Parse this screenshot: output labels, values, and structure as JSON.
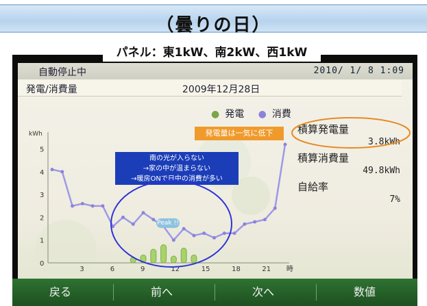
{
  "banner": {
    "title": "（曇りの日）"
  },
  "panel_caption": "パネル：東1kW、南2kW、西1kW",
  "status": {
    "text": "自動停止中",
    "datetime": "2010/ 1/ 8  1:09"
  },
  "screen": {
    "title": "発電/消費量",
    "period": "2009年12月28日"
  },
  "legend": {
    "generation": "発電",
    "consumption": "消費"
  },
  "summary": {
    "gen_label": "積算発電量",
    "gen_value": "3.8kWh",
    "use_label": "積算消費量",
    "use_value": "49.8kWh",
    "ratio_label": "自給率",
    "ratio_value": "7%"
  },
  "notes": {
    "orange": "発電量は一気に低下",
    "blue_lines": [
      "南の光が入らない",
      "→家の中が温まらない",
      "→暖房ONで日中の消費が多い"
    ]
  },
  "peak_badge": "Peak !!",
  "softkeys": {
    "back": "戻る",
    "prev": "前へ",
    "next": "次へ",
    "values": "数値"
  },
  "colors": {
    "banner": "#b7d3ee",
    "frame": "#0c0c0c",
    "softkey_bar": "#2f7232",
    "orange": "#f09a2c",
    "blue": "#1b3db8",
    "consumption_line": "#9e98e6"
  },
  "chart_data": {
    "type": "line",
    "unit": "kWh",
    "x_ticks": [
      "3",
      "6",
      "9",
      "12",
      "15",
      "18",
      "21",
      "時"
    ],
    "y_ticks": [
      "0",
      "1",
      "2",
      "3",
      "4",
      "5"
    ],
    "ylim": [
      0,
      5.5
    ],
    "series": [
      {
        "name": "消費",
        "x": [
          0,
          1,
          2,
          3,
          4,
          5,
          6,
          7,
          8,
          9,
          10,
          11,
          12,
          13,
          14,
          15,
          16,
          17,
          18,
          19,
          20,
          21,
          22,
          23
        ],
        "values": [
          4.1,
          4.0,
          2.5,
          2.6,
          2.5,
          2.5,
          1.6,
          2.0,
          1.7,
          2.2,
          1.9,
          1.6,
          1.0,
          1.5,
          1.2,
          1.3,
          1.1,
          1.3,
          1.3,
          1.7,
          1.8,
          1.9,
          2.4,
          5.2
        ]
      },
      {
        "name": "発電",
        "x": [
          8,
          9,
          10,
          11,
          12,
          13,
          14
        ],
        "values": [
          0.25,
          0.35,
          0.6,
          0.8,
          0.3,
          0.65,
          0.35
        ]
      }
    ]
  }
}
